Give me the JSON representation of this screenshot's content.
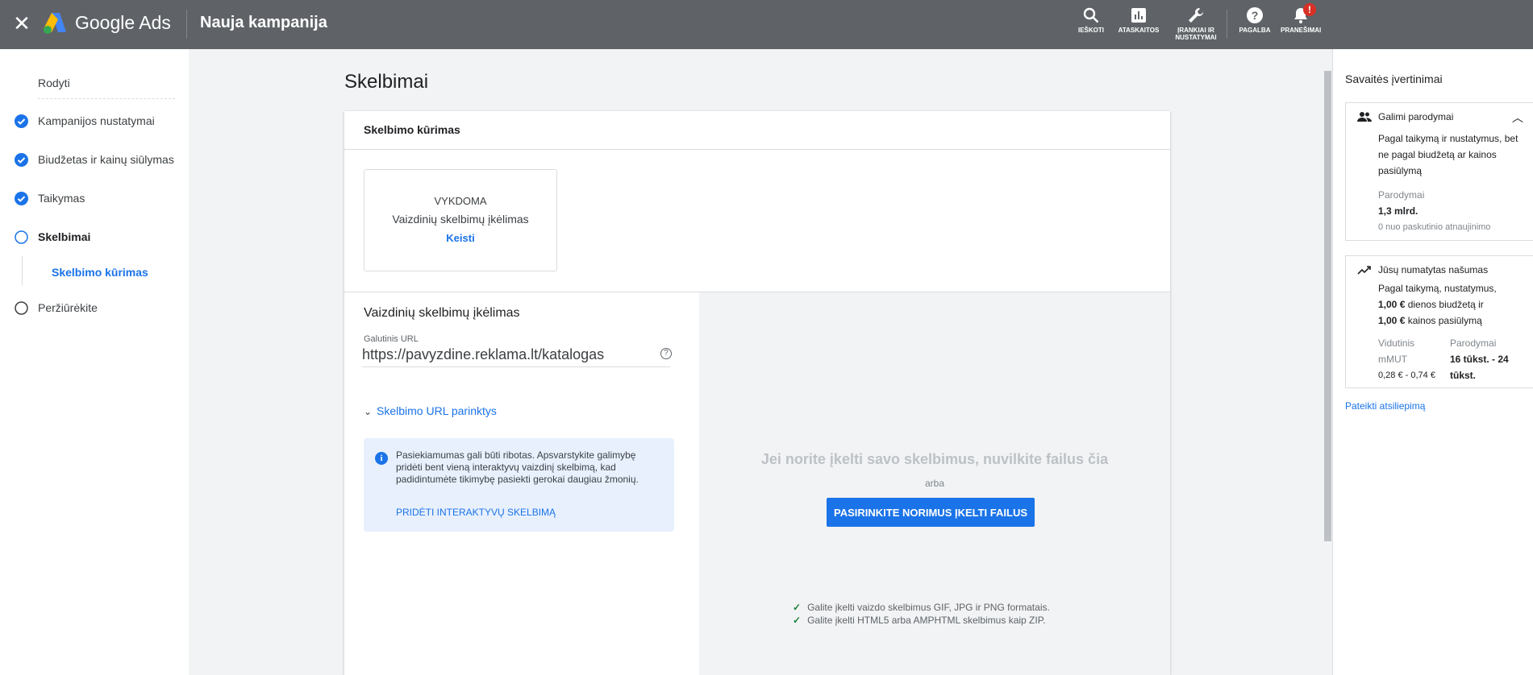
{
  "app": {
    "brand": "Google Ads",
    "campaign_title": "Nauja kampanija",
    "accent": "#1a73e8"
  },
  "topbar_tools": [
    {
      "label": "IEŠKOTI",
      "icon": "search-icon"
    },
    {
      "label": "ATASKAITOS",
      "icon": "reports-icon"
    },
    {
      "label": "ĮRANKIAI IR NUSTATYMAI",
      "icon": "wrench-icon"
    },
    {
      "label": "PAGALBA",
      "icon": "help-icon"
    },
    {
      "label": "PRANEŠIMAI",
      "icon": "bell-icon",
      "badge": "!"
    }
  ],
  "sidebar": {
    "show_label": "Rodyti",
    "steps": [
      {
        "label": "Kampanijos nustatymai",
        "state": "done"
      },
      {
        "label": "Biudžetas ir kainų siūlymas",
        "state": "done"
      },
      {
        "label": "Taikymas",
        "state": "done"
      },
      {
        "label": "Skelbimai",
        "state": "current"
      },
      {
        "label": "Skelbimo kūrimas",
        "state": "sub-active"
      },
      {
        "label": "Peržiūrėkite",
        "state": "todo"
      }
    ]
  },
  "main": {
    "title": "Skelbimai",
    "card_header": "Skelbimo kūrimas",
    "mode": {
      "status": "VYKDOMA",
      "name": "Vaizdinių skelbimų įkėlimas",
      "change": "Keisti"
    },
    "upload_section_title": "Vaizdinių skelbimų įkėlimas",
    "final_url": {
      "label": "Galutinis URL",
      "value": "https://pavyzdine.reklama.lt/katalogas"
    },
    "url_options": "Skelbimo URL parinktys",
    "info": {
      "text": "Pasiekiamumas gali būti ribotas. Apsvarstykite galimybę pridėti bent vieną interaktyvų vaizdinį skelbimą, kad padidintumėte tikimybę pasiekti gerokai daugiau žmonių.",
      "link": "PRIDĖTI INTERAKTYVŲ SKELBIMĄ"
    },
    "dropzone": {
      "title": "Jei norite įkelti savo skelbimus, nuvilkite failus čia",
      "or": "arba",
      "button": "PASIRINKITE NORIMUS ĮKELTI FAILUS",
      "formats": [
        "Galite įkelti vaizdo skelbimus GIF, JPG ir PNG formatais.",
        "Galite įkelti HTML5 arba AMPHTML skelbimus kaip ZIP."
      ]
    }
  },
  "right_panel": {
    "title": "Savaitės įvertinimai",
    "impressions_card": {
      "title": "Galimi parodymai",
      "description": "Pagal taikymą ir nustatymus, bet ne pagal biudžetą ar kainos pasiūlymą",
      "metric_label": "Parodymai",
      "metric_value": "1,3 mlrd.",
      "delta": "0 nuo paskutinio atnaujinimo"
    },
    "performance_card": {
      "title": "Jūsų numatytas našumas",
      "desc_1": "Pagal taikymą, nustatymus,",
      "budget": "1,00 €",
      "desc_2": " dienos biudžetą ir",
      "bid": "1,00 €",
      "desc_3": " kainos pasiūlymą",
      "col1_label": "Vidutinis mMUT",
      "col1_value": "0,28 € - 0,74 €",
      "col2_label": "Parodymai",
      "col2_value": "16 tūkst. - 24 tūkst."
    },
    "feedback_link": "Pateikti atsiliepimą"
  }
}
